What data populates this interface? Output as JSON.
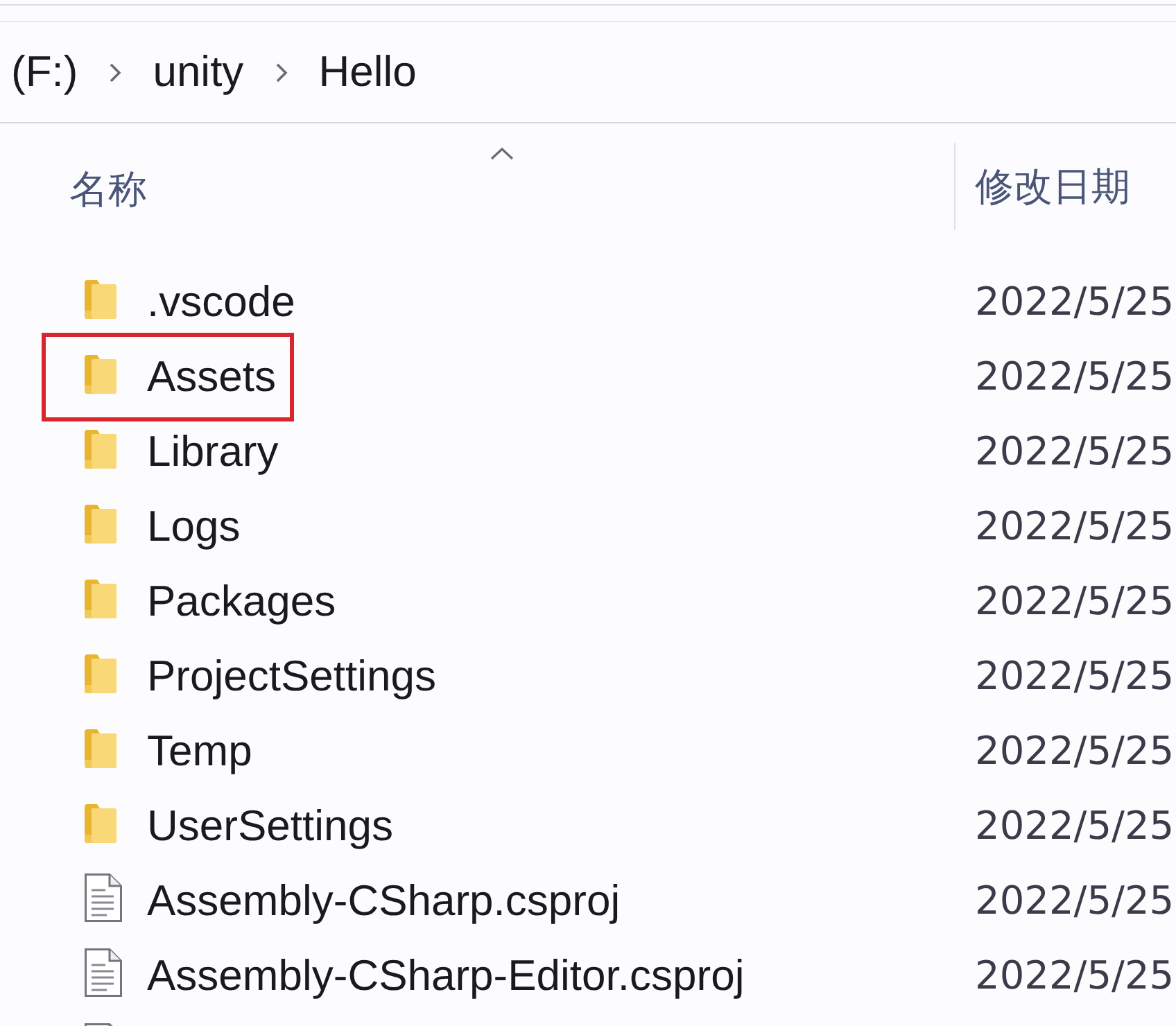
{
  "address_bar": {
    "breadcrumbs": [
      "(F:)",
      "unity",
      "Hello"
    ]
  },
  "columns": [
    {
      "label": "名称",
      "sorted": true
    },
    {
      "label": "修改日期",
      "sorted": false
    }
  ],
  "items": [
    {
      "kind": "folder",
      "name": ".vscode",
      "modified": "2022/5/25",
      "highlighted": false
    },
    {
      "kind": "folder",
      "name": "Assets",
      "modified": "2022/5/25",
      "highlighted": true
    },
    {
      "kind": "folder",
      "name": "Library",
      "modified": "2022/5/25",
      "highlighted": false
    },
    {
      "kind": "folder",
      "name": "Logs",
      "modified": "2022/5/25",
      "highlighted": false
    },
    {
      "kind": "folder",
      "name": "Packages",
      "modified": "2022/5/25",
      "highlighted": false
    },
    {
      "kind": "folder",
      "name": "ProjectSettings",
      "modified": "2022/5/25",
      "highlighted": false
    },
    {
      "kind": "folder",
      "name": "Temp",
      "modified": "2022/5/25",
      "highlighted": false
    },
    {
      "kind": "folder",
      "name": "UserSettings",
      "modified": "2022/5/25",
      "highlighted": false
    },
    {
      "kind": "file",
      "name": "Assembly-CSharp.csproj",
      "modified": "2022/5/25",
      "highlighted": false
    },
    {
      "kind": "file",
      "name": "Assembly-CSharp-Editor.csproj",
      "modified": "2022/5/25",
      "highlighted": false
    },
    {
      "kind": "file",
      "highlighted": false
    }
  ]
}
